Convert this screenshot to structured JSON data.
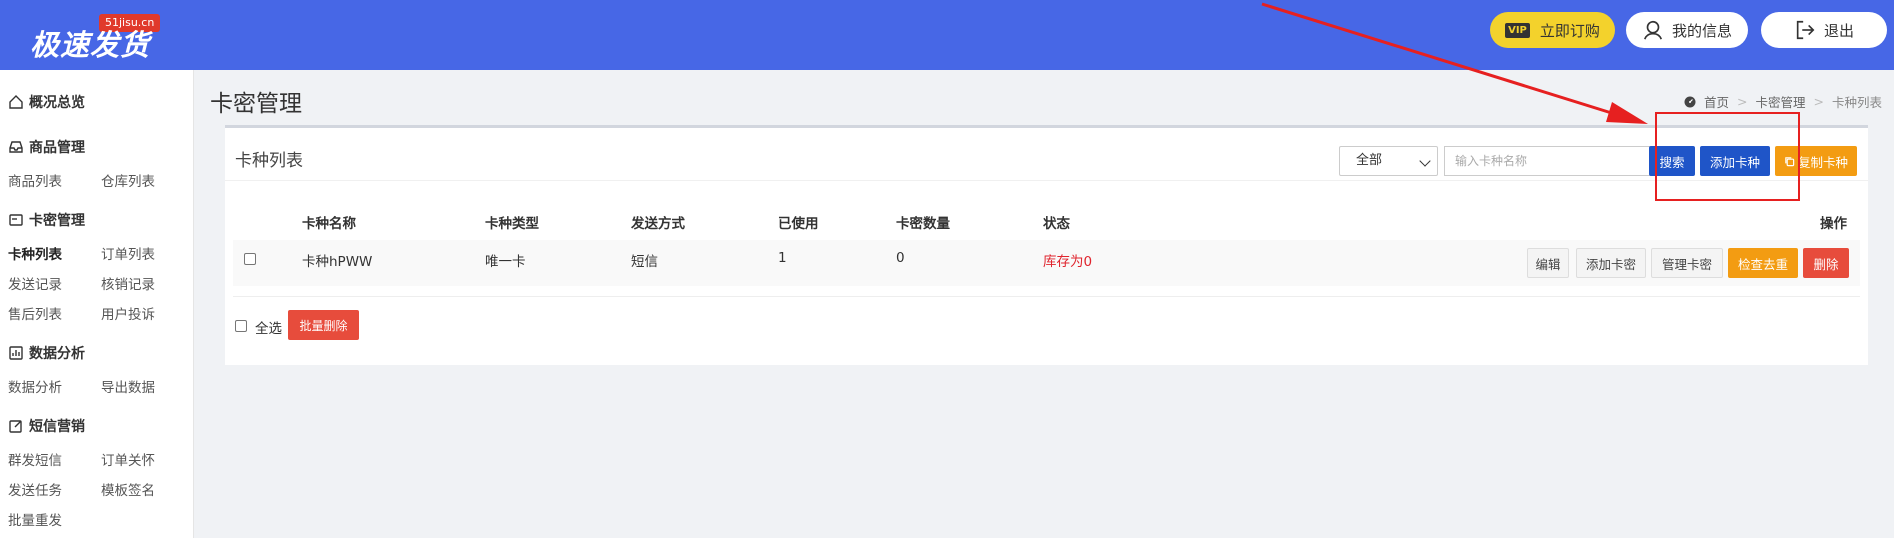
{
  "header": {
    "logo_badge": "51jisu.cn",
    "logo_text": "极速发货",
    "vip_tag": "VIP",
    "vip_label": "立即订购",
    "info_label": "我的信息",
    "logout_label": "退出"
  },
  "sidebar": {
    "overview": "概况总览",
    "product_group": "商品管理",
    "product_list": "商品列表",
    "warehouse_list": "仓库列表",
    "card_group": "卡密管理",
    "card_type_list": "卡种列表",
    "order_list": "订单列表",
    "send_records": "发送记录",
    "verify_records": "核销记录",
    "aftersale_list": "售后列表",
    "user_complaints": "用户投诉",
    "analytics_group": "数据分析",
    "data_analysis": "数据分析",
    "export_data": "导出数据",
    "sms_group": "短信营销",
    "mass_sms": "群发短信",
    "order_care": "订单关怀",
    "send_tasks": "发送任务",
    "template_sign": "模板签名",
    "batch_resend": "批量重发"
  },
  "page": {
    "title": "卡密管理",
    "breadcrumb": [
      "首页",
      "卡密管理",
      "卡种列表"
    ]
  },
  "panel": {
    "title": "卡种列表",
    "filter_selected": "全部",
    "search_placeholder": "输入卡种名称",
    "search_label": "搜索",
    "add_type_label": "添加卡种",
    "copy_type_label": "复制卡种"
  },
  "table": {
    "headers": [
      "卡种名称",
      "卡种类型",
      "发送方式",
      "已使用",
      "卡密数量",
      "状态",
      "操作"
    ],
    "rows": [
      {
        "name": "卡种hPWW",
        "type": "唯一卡",
        "send_method": "短信",
        "used": "1",
        "count": "0",
        "status": "库存为0"
      }
    ],
    "row_actions": [
      "编辑",
      "添加卡密",
      "管理卡密",
      "检查去重",
      "删除"
    ]
  },
  "footer": {
    "select_all_label": "全选",
    "batch_delete_label": "批量删除"
  },
  "colors": {
    "header_bg": "#4767e6",
    "primary_button": "#1f55c8",
    "warning_button": "#f39c12",
    "danger_button": "#e74c3c",
    "vip_button": "#f3d22c",
    "status_red": "#e0242d",
    "annotation_red": "#e62020"
  }
}
